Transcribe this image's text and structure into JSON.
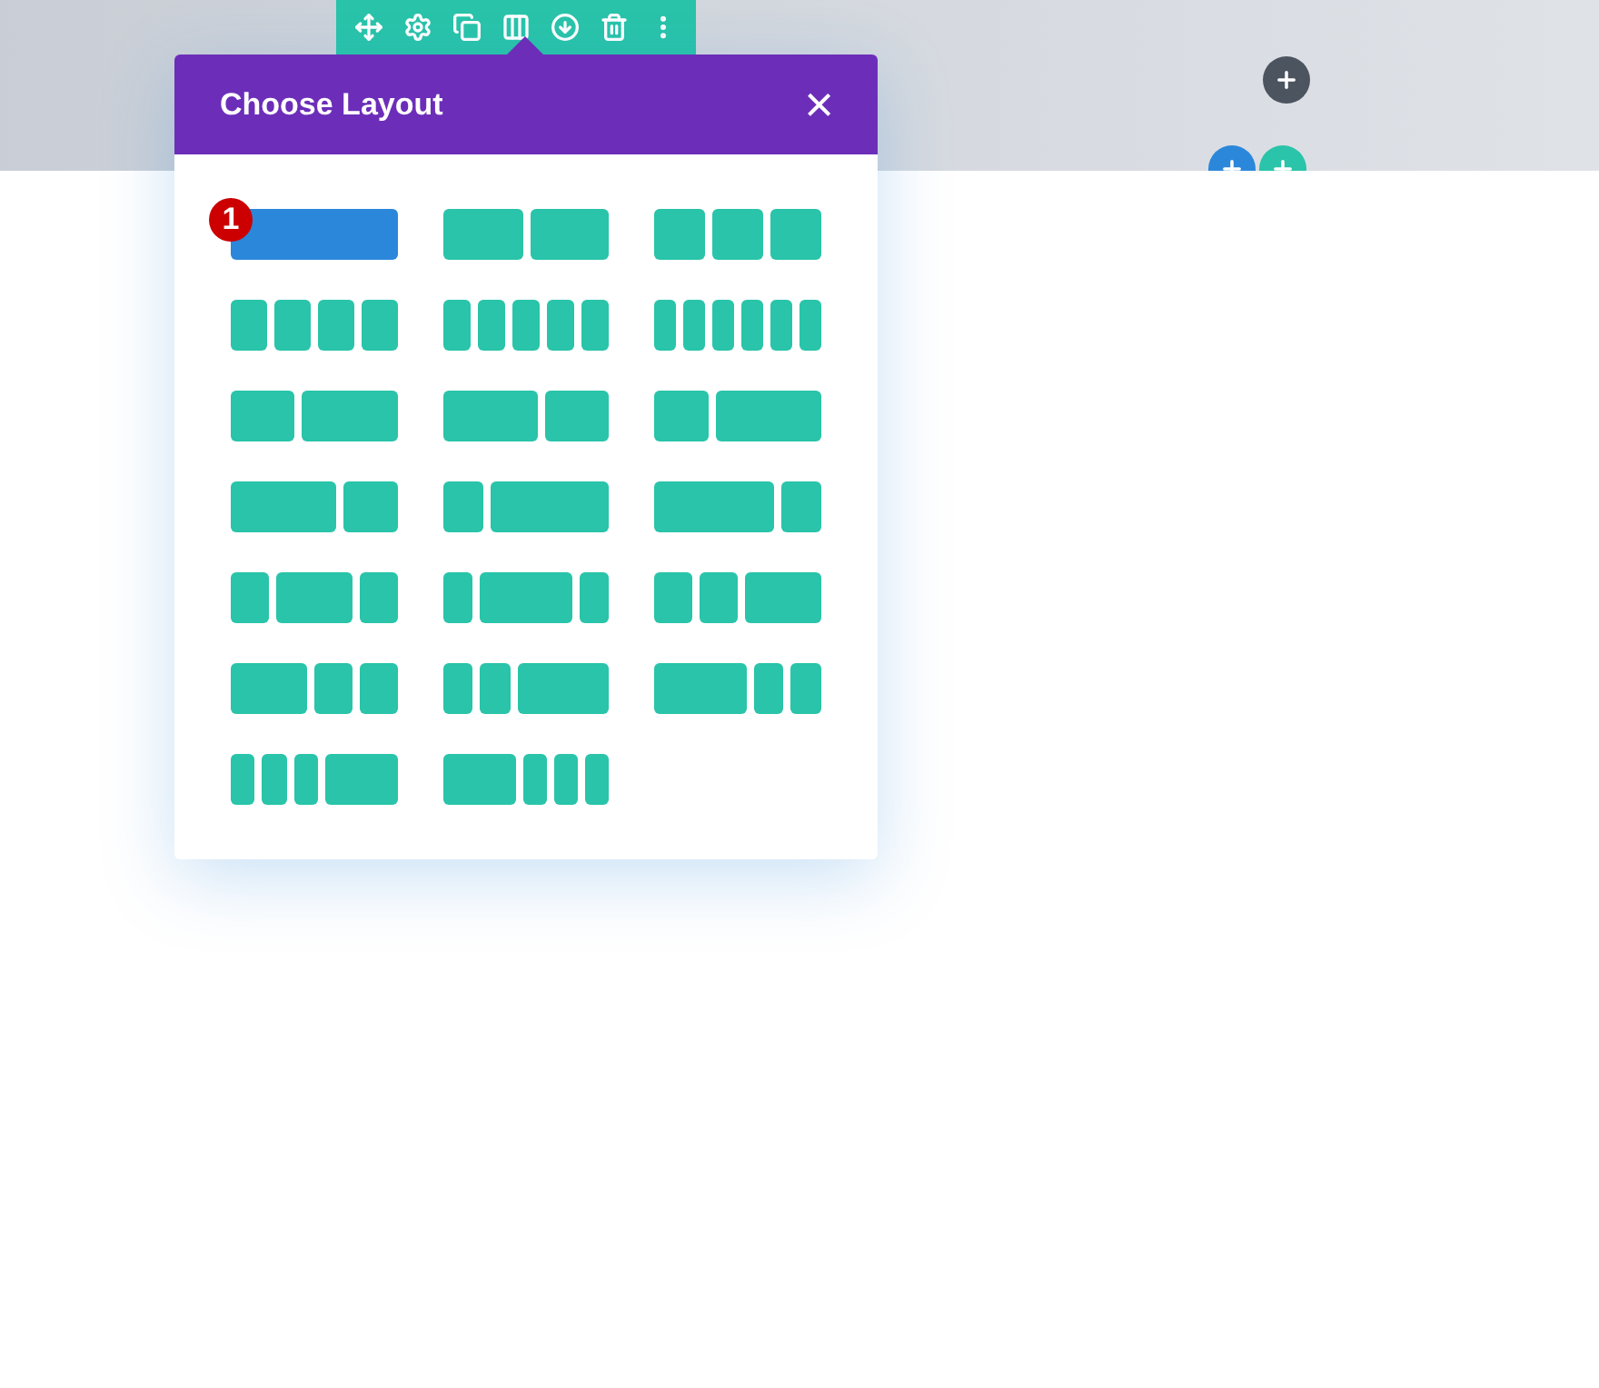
{
  "toolbar": {
    "items": [
      {
        "kind": "move"
      },
      {
        "kind": "settings"
      },
      {
        "kind": "duplicate"
      },
      {
        "kind": "columns"
      },
      {
        "kind": "save"
      },
      {
        "kind": "delete"
      },
      {
        "kind": "more"
      }
    ]
  },
  "modal": {
    "title": "Choose Layout",
    "close": "×",
    "badge": "1",
    "layouts": [
      {
        "kind": "full",
        "selected": true
      },
      {
        "kind": "halves",
        "selected": false
      },
      {
        "kind": "thirds",
        "selected": false
      },
      {
        "kind": "quarters",
        "selected": false
      },
      {
        "kind": "fifths",
        "selected": false
      },
      {
        "kind": "sixths",
        "selected": false
      },
      {
        "kind": "twofifths-threefifths",
        "selected": false
      },
      {
        "kind": "threefifths-twofifths",
        "selected": false
      },
      {
        "kind": "third-twothirds",
        "selected": false
      },
      {
        "kind": "twothirds-third",
        "selected": false
      },
      {
        "kind": "quarter-threequarters",
        "selected": false
      },
      {
        "kind": "threequarters-quarter",
        "selected": false
      },
      {
        "kind": "quarter-half-quarter",
        "selected": false
      },
      {
        "kind": "fifth-threefifths-fifth",
        "selected": false
      },
      {
        "kind": "quarter-quarter-half",
        "selected": false
      },
      {
        "kind": "half-quarter-quarter",
        "selected": false
      },
      {
        "kind": "fifth-fifth-threefifths",
        "selected": false
      },
      {
        "kind": "threefifths-fifth-fifth",
        "selected": false
      },
      {
        "kind": "sixth-sixth-sixth-half",
        "selected": false
      },
      {
        "kind": "half-sixth-sixth-sixth",
        "selected": false
      }
    ]
  },
  "add_buttons": [
    {
      "color": "#4b545f"
    },
    {
      "color": "#2b87da"
    },
    {
      "color": "#29c4a9"
    }
  ]
}
